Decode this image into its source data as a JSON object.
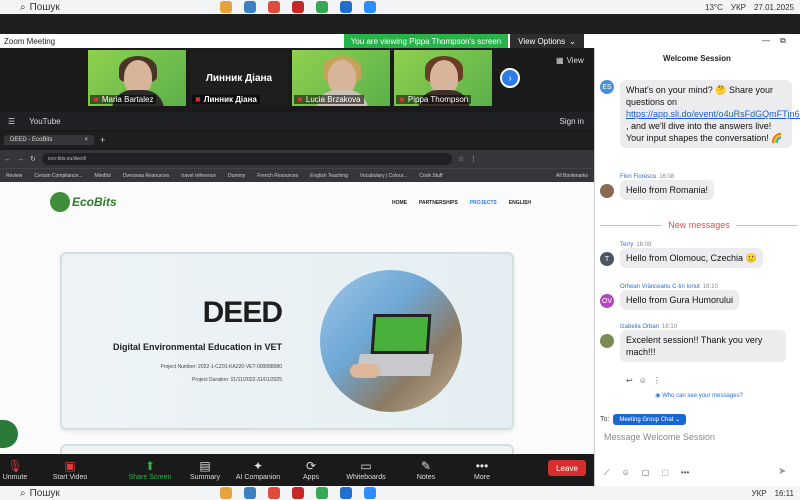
{
  "taskbar": {
    "search_placeholder": "Пошук",
    "temperature": "13°C",
    "lang": "УКР",
    "date_top": "27.01.2025",
    "time_bottom": "16:11"
  },
  "zoom": {
    "window_title": "Zoom Meeting",
    "viewing_banner": "You are viewing Pippa Thompson's screen",
    "view_options": "View Options",
    "view_label": "View",
    "participants": [
      {
        "name": "Maria Bartalez"
      },
      {
        "name": "Линник Діана"
      },
      {
        "name": "Lucia Brzakova"
      },
      {
        "name": "Pippa Thompson"
      }
    ],
    "center_tile_name": "Линник Діана",
    "toolbar": [
      {
        "label": "Unmute",
        "icon": "mic-muted-icon"
      },
      {
        "label": "Start Video",
        "icon": "video-off-icon"
      },
      {
        "label": "Share Screen",
        "icon": "share-screen-icon"
      },
      {
        "label": "Summary",
        "icon": "summary-icon"
      },
      {
        "label": "AI Companion",
        "icon": "sparkle-icon"
      },
      {
        "label": "Apps",
        "icon": "apps-icon"
      },
      {
        "label": "Whiteboards",
        "icon": "whiteboard-icon"
      },
      {
        "label": "Notes",
        "icon": "notes-icon"
      },
      {
        "label": "More",
        "icon": "more-icon"
      }
    ],
    "leave": "Leave"
  },
  "browser": {
    "youtube": "YouTube",
    "sign_in": "Sign in",
    "tab_title": "DEED - EcoBits",
    "address": "eco-bits.eu/deed/",
    "bookmarks": [
      "Review",
      "Certain Compliance...",
      "Mindful",
      "Overseas Resources",
      "travel reference",
      "Dummy",
      "French Resources",
      "English Teaching",
      "Vocabulary | Colour...",
      "Cook Stuff",
      "All Bookmarks"
    ]
  },
  "site": {
    "logo": "EcoBits",
    "nav": [
      "HOME",
      "PARTNERSHIPS",
      "PROJECTS",
      "ENGLISH"
    ],
    "hero_title": "DEED",
    "hero_subtitle": "Digital Environmental Education in VET",
    "project_number": "Project Number: 2022-1-CZ01-KA220-VET-000088080",
    "project_duration": "Project Duration: 01/11/2022-31/01/2025"
  },
  "chat": {
    "title": "Welcome Session",
    "messages": [
      {
        "avatar": "ES",
        "avatar_color": "#4a8fd6",
        "sender": "",
        "time": "",
        "text_before": "What's on your mind? 🤔 Share your questions on ",
        "link": "https://app.sli.do/event/o4uRsFdGQmFTjn6c5Mywfe",
        "text_after": " , and we'll dive into the answers live! Your input shapes the conversation! 🌈"
      },
      {
        "avatar": "",
        "avatar_color": "#8a6b52",
        "sender": "Flori Florescu",
        "time": "16:08",
        "text": "Hello from Romania!"
      },
      {
        "avatar": "T",
        "avatar_color": "#4b5563",
        "sender": "Terry",
        "time": "16:09",
        "text": "Hello from Olomouc, Czechia 🙂"
      },
      {
        "avatar": "OV",
        "avatar_color": "#b04ab8",
        "sender": "Orhean Vrânceanu C-tin Ionut",
        "time": "16:10",
        "text": "Hello from Gura Humorului"
      },
      {
        "avatar": "",
        "avatar_color": "#7a8b55",
        "sender": "Izabella Orban",
        "time": "16:10",
        "text": "Excelent session!! Thank you very mach!!!"
      }
    ],
    "new_messages": "New messages",
    "who_can_see": "Who can see your messages?",
    "to_label": "To:",
    "to_target": "Meeting Group Chat",
    "input_placeholder": "Message Welcome Session"
  }
}
